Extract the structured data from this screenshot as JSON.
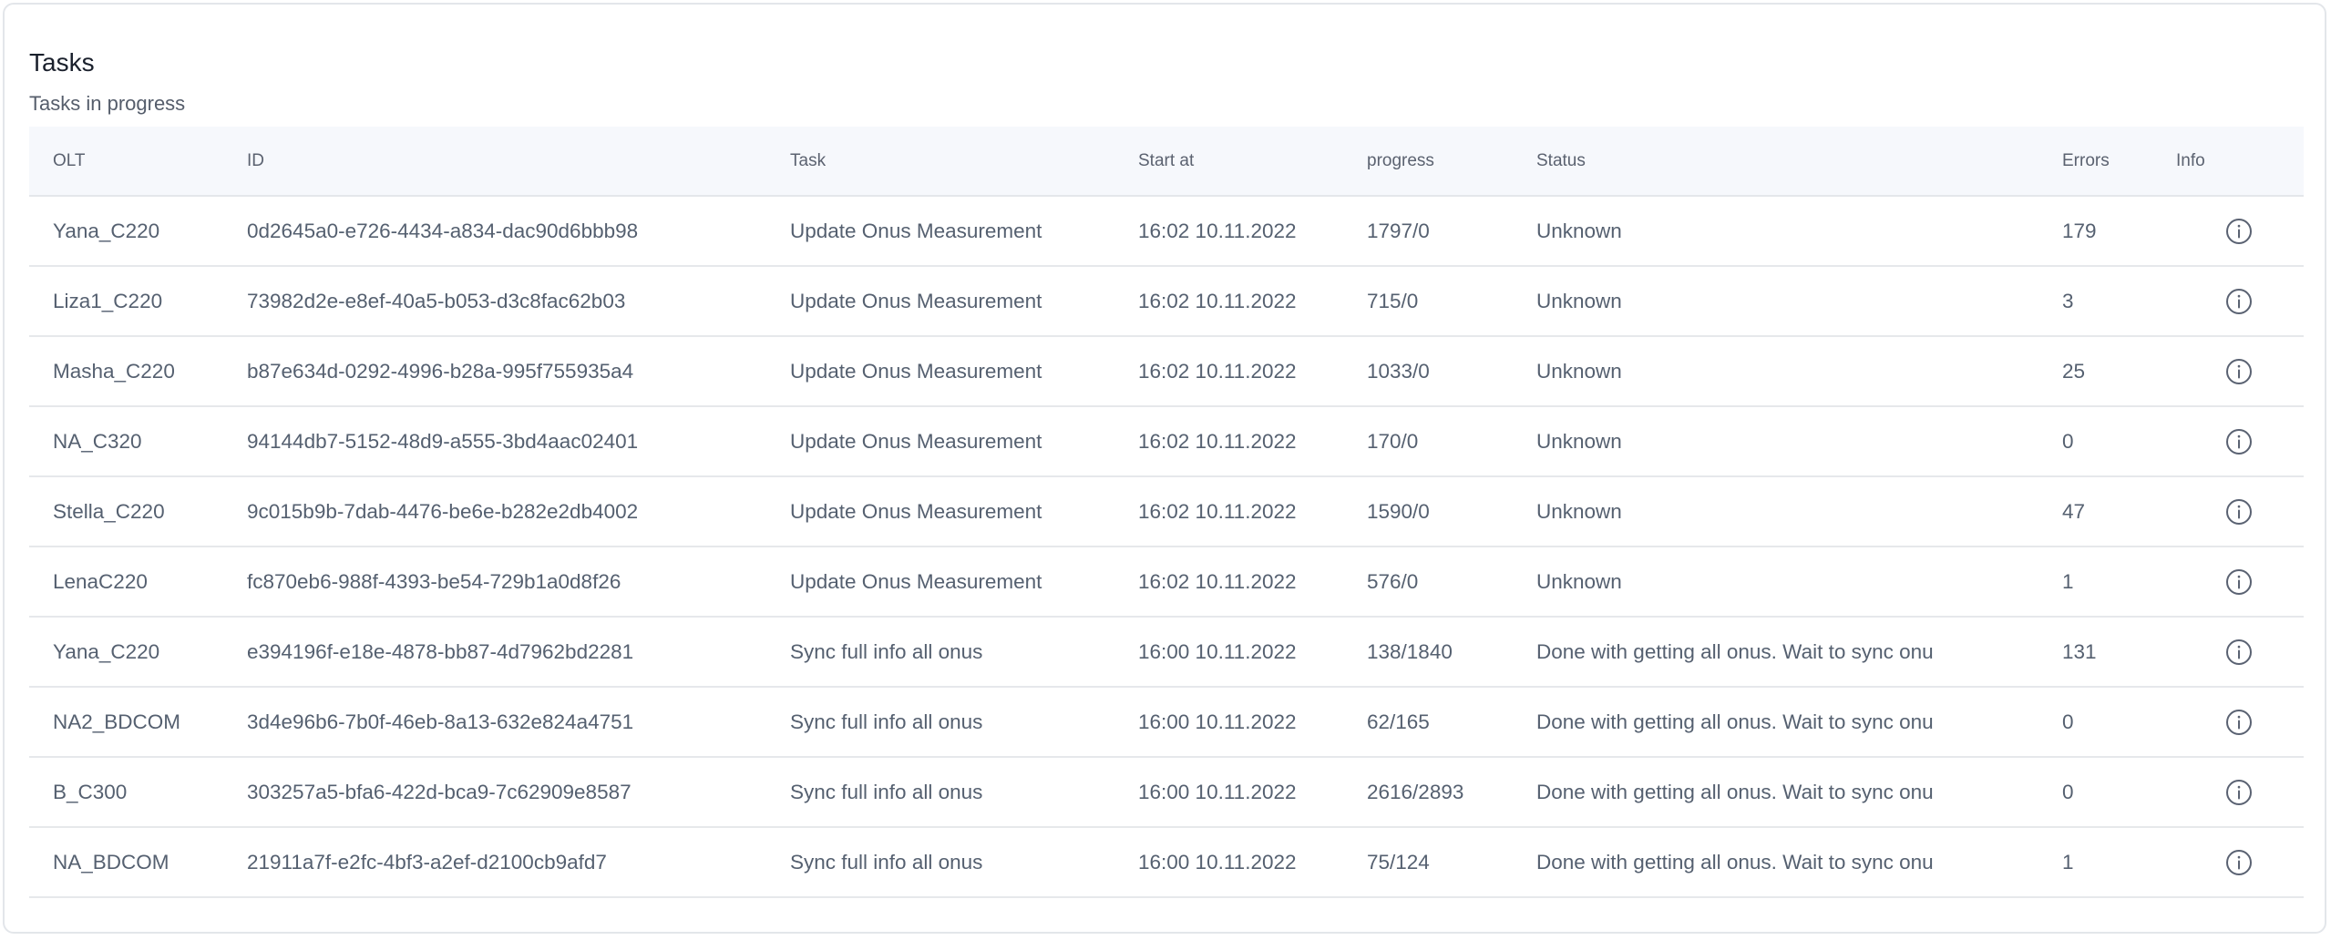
{
  "card": {
    "title": "Tasks",
    "subtitle": "Tasks in progress"
  },
  "table": {
    "headers": {
      "olt": "OLT",
      "id": "ID",
      "task": "Task",
      "start_at": "Start at",
      "progress": "progress",
      "status": "Status",
      "errors": "Errors",
      "info": "Info"
    },
    "rows": [
      {
        "olt": "Yana_C220",
        "id": "0d2645a0-e726-4434-a834-dac90d6bbb98",
        "task": "Update Onus Measurement",
        "start_at": "16:02 10.11.2022",
        "progress": "1797/0",
        "status": "Unknown",
        "errors": "179"
      },
      {
        "olt": "Liza1_C220",
        "id": "73982d2e-e8ef-40a5-b053-d3c8fac62b03",
        "task": "Update Onus Measurement",
        "start_at": "16:02 10.11.2022",
        "progress": "715/0",
        "status": "Unknown",
        "errors": "3"
      },
      {
        "olt": "Masha_C220",
        "id": "b87e634d-0292-4996-b28a-995f755935a4",
        "task": "Update Onus Measurement",
        "start_at": "16:02 10.11.2022",
        "progress": "1033/0",
        "status": "Unknown",
        "errors": "25"
      },
      {
        "olt": "NA_C320",
        "id": "94144db7-5152-48d9-a555-3bd4aac02401",
        "task": "Update Onus Measurement",
        "start_at": "16:02 10.11.2022",
        "progress": "170/0",
        "status": "Unknown",
        "errors": "0"
      },
      {
        "olt": "Stella_C220",
        "id": "9c015b9b-7dab-4476-be6e-b282e2db4002",
        "task": "Update Onus Measurement",
        "start_at": "16:02 10.11.2022",
        "progress": "1590/0",
        "status": "Unknown",
        "errors": "47"
      },
      {
        "olt": "LenaC220",
        "id": "fc870eb6-988f-4393-be54-729b1a0d8f26",
        "task": "Update Onus Measurement",
        "start_at": "16:02 10.11.2022",
        "progress": "576/0",
        "status": "Unknown",
        "errors": "1"
      },
      {
        "olt": "Yana_C220",
        "id": "e394196f-e18e-4878-bb87-4d7962bd2281",
        "task": "Sync full info all onus",
        "start_at": "16:00 10.11.2022",
        "progress": "138/1840",
        "status": "Done with getting all onus. Wait to sync onu",
        "errors": "131"
      },
      {
        "olt": "NA2_BDCOM",
        "id": "3d4e96b6-7b0f-46eb-8a13-632e824a4751",
        "task": "Sync full info all onus",
        "start_at": "16:00 10.11.2022",
        "progress": "62/165",
        "status": "Done with getting all onus. Wait to sync onu",
        "errors": "0"
      },
      {
        "olt": "B_C300",
        "id": "303257a5-bfa6-422d-bca9-7c62909e8587",
        "task": "Sync full info all onus",
        "start_at": "16:00 10.11.2022",
        "progress": "2616/2893",
        "status": "Done with getting all onus. Wait to sync onu",
        "errors": "0"
      },
      {
        "olt": "NA_BDCOM",
        "id": "21911a7f-e2fc-4bf3-a2ef-d2100cb9afd7",
        "task": "Sync full info all onus",
        "start_at": "16:00 10.11.2022",
        "progress": "75/124",
        "status": "Done with getting all onus. Wait to sync onu",
        "errors": "1"
      }
    ],
    "row_action_icon": "info-circle-icon"
  },
  "colors": {
    "card_border": "#e3e6ea",
    "header_bg": "#f6f8fc",
    "title_text": "#1a202c",
    "body_text": "#556070",
    "icon_stroke": "#5a6272"
  }
}
